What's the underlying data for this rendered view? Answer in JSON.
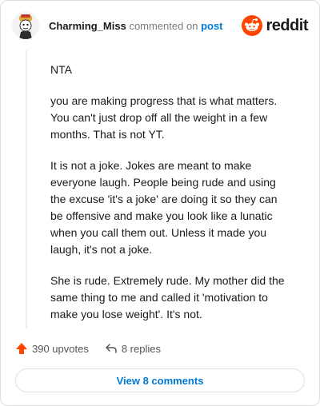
{
  "header": {
    "username": "Charming_Miss",
    "commented_on": "commented on",
    "post_link": "post",
    "brand": "reddit"
  },
  "comment": {
    "paragraphs": [
      "NTA",
      "you are making progress that is what matters. You can't just drop off all the weight in a few months. That is not YT.",
      "It is not a joke. Jokes are meant to make everyone laugh. People being rude and using the excuse 'it's a joke' are doing it so they can be offensive and make you look like a lunatic when you call them out. Unless it made you laugh, it's not a joke.",
      "She is rude. Extremely rude. My mother did the same thing to me and called it 'motivation to make you lose weight'. It's not."
    ]
  },
  "actions": {
    "upvotes": "390 upvotes",
    "replies": "8 replies"
  },
  "footer": {
    "view_comments": "View 8 comments"
  },
  "colors": {
    "accent": "#0079d3",
    "upvote": "#ff4500",
    "brand": "#ff4500"
  },
  "icons": [
    "avatar",
    "reddit-logo-icon",
    "upvote-arrow-icon",
    "reply-arrow-icon"
  ]
}
